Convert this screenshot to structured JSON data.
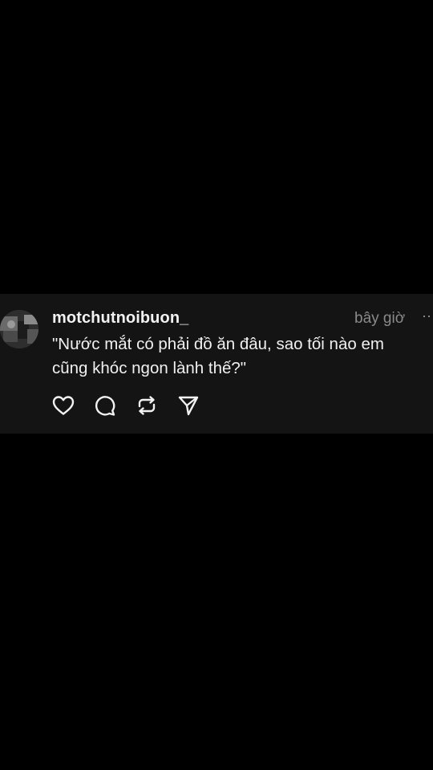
{
  "post": {
    "username": "motchutnoibuon_",
    "timestamp": "bây giờ",
    "more_label": "···",
    "text": "\"Nước mắt có phải đồ ăn đâu, sao tối nào em cũng khóc ngon lành thế?\"",
    "actions": [
      {
        "name": "like",
        "icon": "heart-icon"
      },
      {
        "name": "comment",
        "icon": "speech-bubble-icon"
      },
      {
        "name": "repost",
        "icon": "repost-icon"
      },
      {
        "name": "share",
        "icon": "send-icon"
      }
    ]
  },
  "colors": {
    "background": "#000000",
    "card": "#141414",
    "text": "#f0f0f0",
    "muted": "#8a8a8a"
  }
}
